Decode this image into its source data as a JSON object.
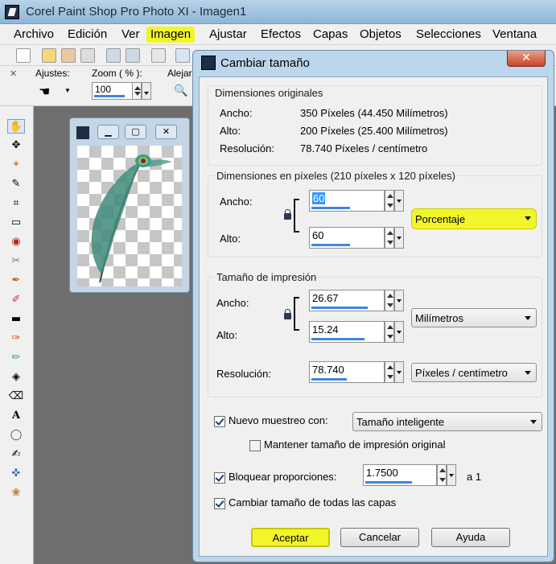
{
  "app": {
    "title": "Corel Paint Shop Pro Photo XI - Imagen1",
    "menu": [
      "Archivo",
      "Edición",
      "Ver",
      "Imagen",
      "Ajustar",
      "Efectos",
      "Capas",
      "Objetos",
      "Selecciones",
      "Ventana"
    ],
    "highlighted_menu": "Imagen",
    "highlight_color": "#f2f52a"
  },
  "tool_options": {
    "ajustes_label": "Ajustes:",
    "zoom_label": "Zoom ( % ):",
    "zoom_value": "100",
    "alejar_label": "Alejar"
  },
  "dialog": {
    "title": "Cambiar tamaño",
    "original": {
      "heading": "Dimensiones originales",
      "ancho_label": "Ancho:",
      "ancho_value": "350 Píxeles (44.450 Milímetros)",
      "alto_label": "Alto:",
      "alto_value": "200 Píxeles (25.400 Milímetros)",
      "res_label": "Resolución:",
      "res_value": "78.740 Píxeles / centímetro"
    },
    "pixel": {
      "heading": "Dimensiones en píxeles (210 píxeles x 120 píxeles)",
      "ancho_label": "Ancho:",
      "ancho_value": "60",
      "alto_label": "Alto:",
      "alto_value": "60",
      "unit": "Porcentaje"
    },
    "print": {
      "heading": "Tamaño de impresión",
      "ancho_label": "Ancho:",
      "ancho_value": "26.67",
      "alto_label": "Alto:",
      "alto_value": "15.24",
      "unit": "Milímetros",
      "res_label": "Resolución:",
      "res_value": "78.740",
      "res_unit": "Píxeles / centímetro"
    },
    "resample_label": "Nuevo muestreo con:",
    "resample_value": "Tamaño inteligente",
    "keep_print_label": "Mantener tamaño de impresión original",
    "lock_label": "Bloquear proporciones:",
    "lock_value": "1.7500",
    "lock_suffix": "a 1",
    "all_layers_label": "Cambiar tamaño de todas las capas",
    "ok_label": "Aceptar",
    "cancel_label": "Cancelar",
    "help_label": "Ayuda"
  }
}
